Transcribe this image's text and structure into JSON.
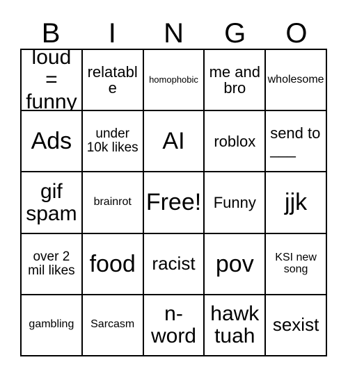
{
  "card": {
    "header_letters": [
      "B",
      "I",
      "N",
      "G",
      "O"
    ],
    "rows": [
      [
        {
          "text": "loud = funny",
          "size": "fs-xl"
        },
        {
          "text": "relatable",
          "size": "fs-md"
        },
        {
          "text": "homophobic",
          "size": "fs-xxs"
        },
        {
          "text": "me and bro",
          "size": "fs-md"
        },
        {
          "text": "wholesome",
          "size": "fs-xs"
        }
      ],
      [
        {
          "text": "Ads",
          "size": "fs-xxl"
        },
        {
          "text": "under 10k likes",
          "size": "fs-sm"
        },
        {
          "text": "AI",
          "size": "fs-xxl"
        },
        {
          "text": "roblox",
          "size": "fs-md"
        },
        {
          "text": "send to ___",
          "size": "fs-md"
        }
      ],
      [
        {
          "text": "gif spam",
          "size": "fs-xl"
        },
        {
          "text": "brainrot",
          "size": "fs-xs"
        },
        {
          "text": "Free!",
          "size": "fs-xxl"
        },
        {
          "text": "Funny",
          "size": "fs-md"
        },
        {
          "text": "jjk",
          "size": "fs-xxl"
        }
      ],
      [
        {
          "text": "over 2 mil likes",
          "size": "fs-sm"
        },
        {
          "text": "food",
          "size": "fs-xxl"
        },
        {
          "text": "racist",
          "size": "fs-lg"
        },
        {
          "text": "pov",
          "size": "fs-xxl"
        },
        {
          "text": "KSI new song",
          "size": "fs-xs"
        }
      ],
      [
        {
          "text": "gambling",
          "size": "fs-xs"
        },
        {
          "text": "Sarcasm",
          "size": "fs-xs"
        },
        {
          "text": "n-word",
          "size": "fs-xl"
        },
        {
          "text": "hawk tuah",
          "size": "fs-xl"
        },
        {
          "text": "sexist",
          "size": "fs-lg"
        }
      ]
    ],
    "free_space": "Free!",
    "colors": {
      "border": "#000000",
      "text": "#000000",
      "background": "#ffffff"
    }
  }
}
